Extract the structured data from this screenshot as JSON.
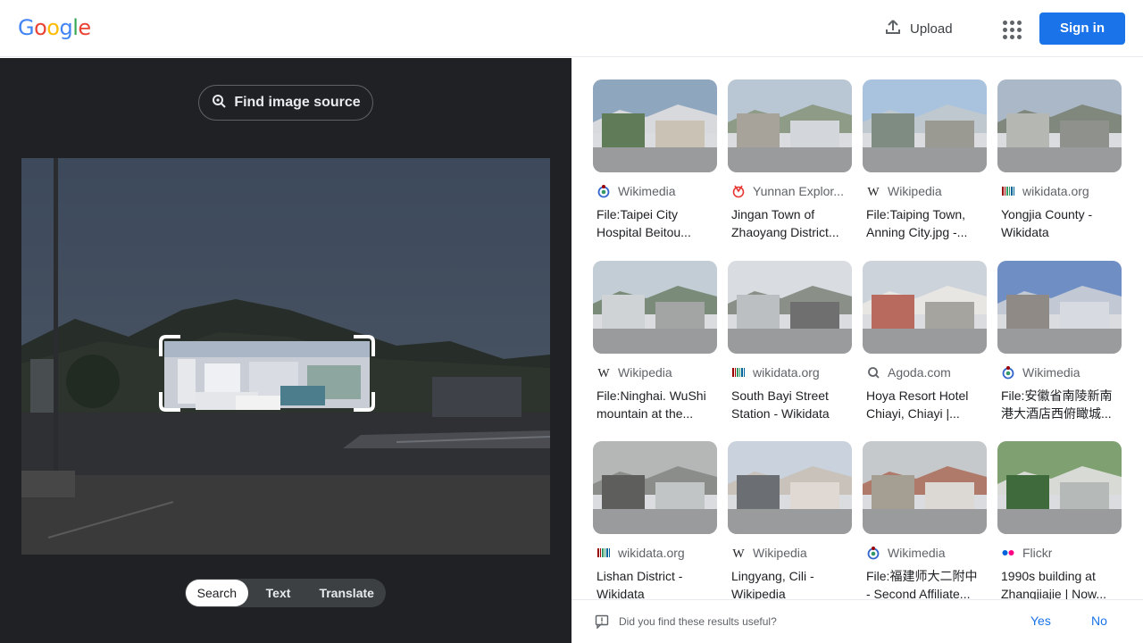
{
  "header": {
    "logo_letters": [
      "G",
      "o",
      "o",
      "g",
      "l",
      "e"
    ],
    "logo_colors": [
      "#4285f4",
      "#ea4335",
      "#fbbc05",
      "#4285f4",
      "#34a853",
      "#ea4335"
    ],
    "upload_label": "Upload",
    "signin_label": "Sign in"
  },
  "left": {
    "find_source_label": "Find image source",
    "modes": [
      "Search",
      "Text",
      "Translate"
    ],
    "active_mode": "Search"
  },
  "results": [
    {
      "source": "Wikimedia",
      "title": "File:Taipei City Hospital Beitou...",
      "favicon": "wikimedia-icon"
    },
    {
      "source": "Yunnan Explor...",
      "title": "Jingan Town of Zhaoyang District...",
      "favicon": "yunnan-explore-icon"
    },
    {
      "source": "Wikipedia",
      "title": "File:Taiping Town, Anning City.jpg -...",
      "favicon": "wikipedia-icon"
    },
    {
      "source": "wikidata.org",
      "title": "Yongjia County - Wikidata",
      "favicon": "wikidata-icon"
    },
    {
      "source": "Wikipedia",
      "title": "File:Ninghai. WuShi mountain at the...",
      "favicon": "wikipedia-icon"
    },
    {
      "source": "wikidata.org",
      "title": "South Bayi Street Station - Wikidata",
      "favicon": "wikidata-icon"
    },
    {
      "source": "Agoda.com",
      "title": "Hoya Resort Hotel Chiayi, Chiayi |...",
      "favicon": "agoda-icon"
    },
    {
      "source": "Wikimedia",
      "title": "File:安徽省南陵新南港大酒店西俯瞰城...",
      "favicon": "wikimedia-icon"
    },
    {
      "source": "wikidata.org",
      "title": "Lishan District - Wikidata",
      "favicon": "wikidata-icon"
    },
    {
      "source": "Wikipedia",
      "title": "Lingyang, Cili - Wikipedia",
      "favicon": "wikipedia-icon"
    },
    {
      "source": "Wikimedia",
      "title": "File:福建师大二附中 - Second Affiliate...",
      "favicon": "wikimedia-icon"
    },
    {
      "source": "Flickr",
      "title": "1990s building at Zhangjiajie | Now...",
      "favicon": "flickr-icon"
    }
  ],
  "feedback": {
    "question": "Did you find these results useful?",
    "yes_label": "Yes",
    "no_label": "No"
  }
}
